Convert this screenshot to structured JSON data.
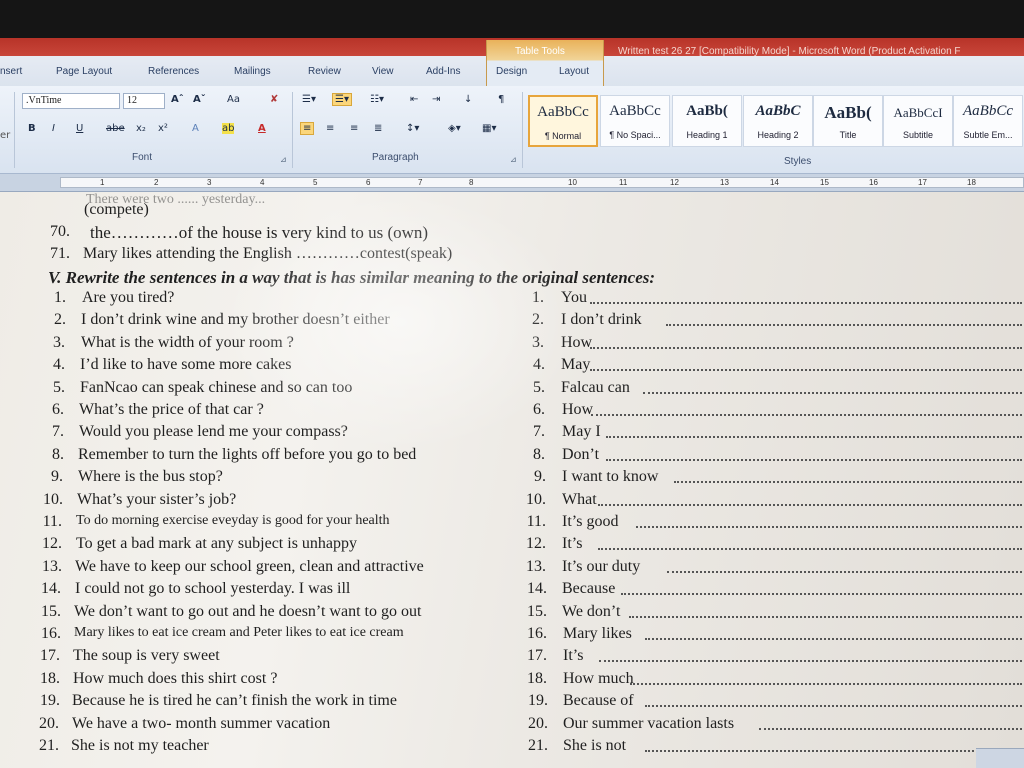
{
  "window": {
    "title": "Written test 26 27 [Compatibility Mode] - Microsoft Word (Product Activation F",
    "contextual_tab_group": "Table Tools"
  },
  "ribbon_tabs": [
    "nsert",
    "Page Layout",
    "References",
    "Mailings",
    "Review",
    "View",
    "Add-Ins",
    "Design",
    "Layout"
  ],
  "ribbon": {
    "font_name": ".VnTime",
    "font_size": "12",
    "font_group_label": "Font",
    "paragraph_group_label": "Paragraph",
    "styles_group_label": "Styles",
    "clipboard_partial_label": "er",
    "font_buttons": {
      "grow": "Aˆ",
      "shrink": "Aˇ",
      "change_case": "Aa",
      "clear": "✘",
      "bold": "B",
      "italic": "I",
      "underline": "U",
      "strike": "abe",
      "subscript": "x₂",
      "superscript": "x²",
      "effects": "A",
      "highlight": "ab",
      "font_color": "A"
    },
    "styles": [
      {
        "sample": "AaBbCc",
        "name": "¶ Normal"
      },
      {
        "sample": "AaBbCc",
        "name": "¶ No Spaci..."
      },
      {
        "sample": "AaBb(",
        "name": "Heading 1"
      },
      {
        "sample": "AaBbC",
        "name": "Heading 2"
      },
      {
        "sample": "AaBb(",
        "name": "Title"
      },
      {
        "sample": "AaBbCcI",
        "name": "Subtitle"
      },
      {
        "sample": "AaBbCc",
        "name": "Subtle Em..."
      }
    ]
  },
  "ruler": {
    "numbers": [
      "1",
      "2",
      "3",
      "4",
      "5",
      "6",
      "7",
      "8",
      "10",
      "11",
      "12",
      "13",
      "14",
      "15",
      "16",
      "17",
      "18"
    ]
  },
  "document": {
    "cutoff_line": "There were two ...... yesterday...",
    "pre_lines": [
      {
        "num": "",
        "text": "(compete)"
      },
      {
        "num": "70.",
        "text": "the…………of the house is very kind to us (own)"
      },
      {
        "num": "71.",
        "text": "Mary likes attending the English …………contest(speak)"
      }
    ],
    "section_heading": "V. Rewrite the sentences in a way that is has similar meaning to the original sentences:",
    "items": [
      {
        "n": "1.",
        "original": "Are you tired?",
        "start": "You"
      },
      {
        "n": "2.",
        "original": "I don’t drink wine and my brother doesn’t either",
        "start": "I don’t drink"
      },
      {
        "n": "3.",
        "original": "What is the width of your room ?",
        "start": "How"
      },
      {
        "n": "4.",
        "original": "I’d like to have some more cakes",
        "start": "May"
      },
      {
        "n": "5.",
        "original": "FanNcao can speak chinese and so can too",
        "start": "Falcau can"
      },
      {
        "n": "6.",
        "original": "What’s the price of that car ?",
        "start": "How"
      },
      {
        "n": "7.",
        "original": "Would you please lend me your compass?",
        "start": "May I"
      },
      {
        "n": "8.",
        "original": "Remember to turn the lights off before you go to bed",
        "start": "Don’t"
      },
      {
        "n": "9.",
        "original": "Where is the bus stop?",
        "start": "I want to know"
      },
      {
        "n": "10.",
        "original": "What’s your sister’s job?",
        "start": "What"
      },
      {
        "n": "11.",
        "original": "To do morning exercise eveyday is good for your health",
        "start": "It’s good"
      },
      {
        "n": "12.",
        "original": "To get a bad mark at any subject is unhappy",
        "start": "It’s"
      },
      {
        "n": "13.",
        "original": "We have to keep our school green, clean and attractive",
        "start": "It’s our duty"
      },
      {
        "n": "14.",
        "original": "I could not go to school yesterday. I was ill",
        "start": "Because"
      },
      {
        "n": "15.",
        "original": "We don’t want to go out and he doesn’t want to go out",
        "start": "We don’t"
      },
      {
        "n": "16.",
        "original": "Mary likes to eat ice cream and Peter likes to eat ice cream",
        "start": "Mary likes"
      },
      {
        "n": "17.",
        "original": "The soup is very sweet",
        "start": "It’s"
      },
      {
        "n": "18.",
        "original": "How much does this shirt cost ?",
        "start": "How much"
      },
      {
        "n": "19.",
        "original": "Because he is tired he can’t finish the work in time",
        "start": "Because of"
      },
      {
        "n": "20.",
        "original": "We have a two- month summer vacation",
        "start": "Our summer vacation lasts"
      },
      {
        "n": "21.",
        "original": "She is not my teacher",
        "start": "She is not"
      }
    ]
  }
}
